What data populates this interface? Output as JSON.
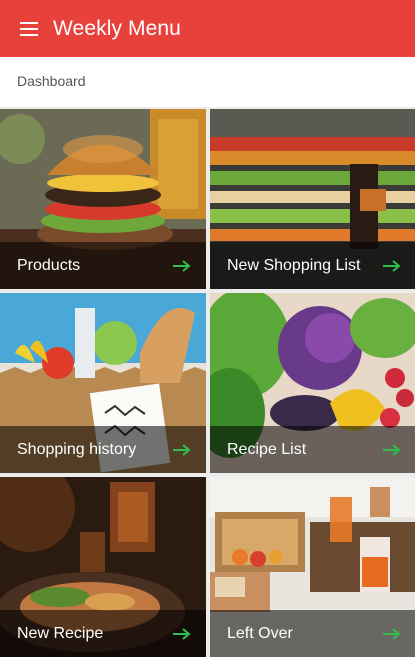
{
  "app": {
    "title": "Weekly Menu"
  },
  "breadcrumb": {
    "label": "Dashboard"
  },
  "colors": {
    "primary": "#e8413b",
    "arrow": "#2fbf4a"
  },
  "tiles": [
    {
      "label": "Products",
      "icon": "arrow-right-icon"
    },
    {
      "label": "New Shopping List",
      "icon": "arrow-right-icon"
    },
    {
      "label": "Shopping history",
      "icon": "arrow-right-icon"
    },
    {
      "label": "Recipe List",
      "icon": "arrow-right-icon"
    },
    {
      "label": "New Recipe",
      "icon": "arrow-right-icon"
    },
    {
      "label": "Left Over",
      "icon": "arrow-right-icon"
    }
  ]
}
